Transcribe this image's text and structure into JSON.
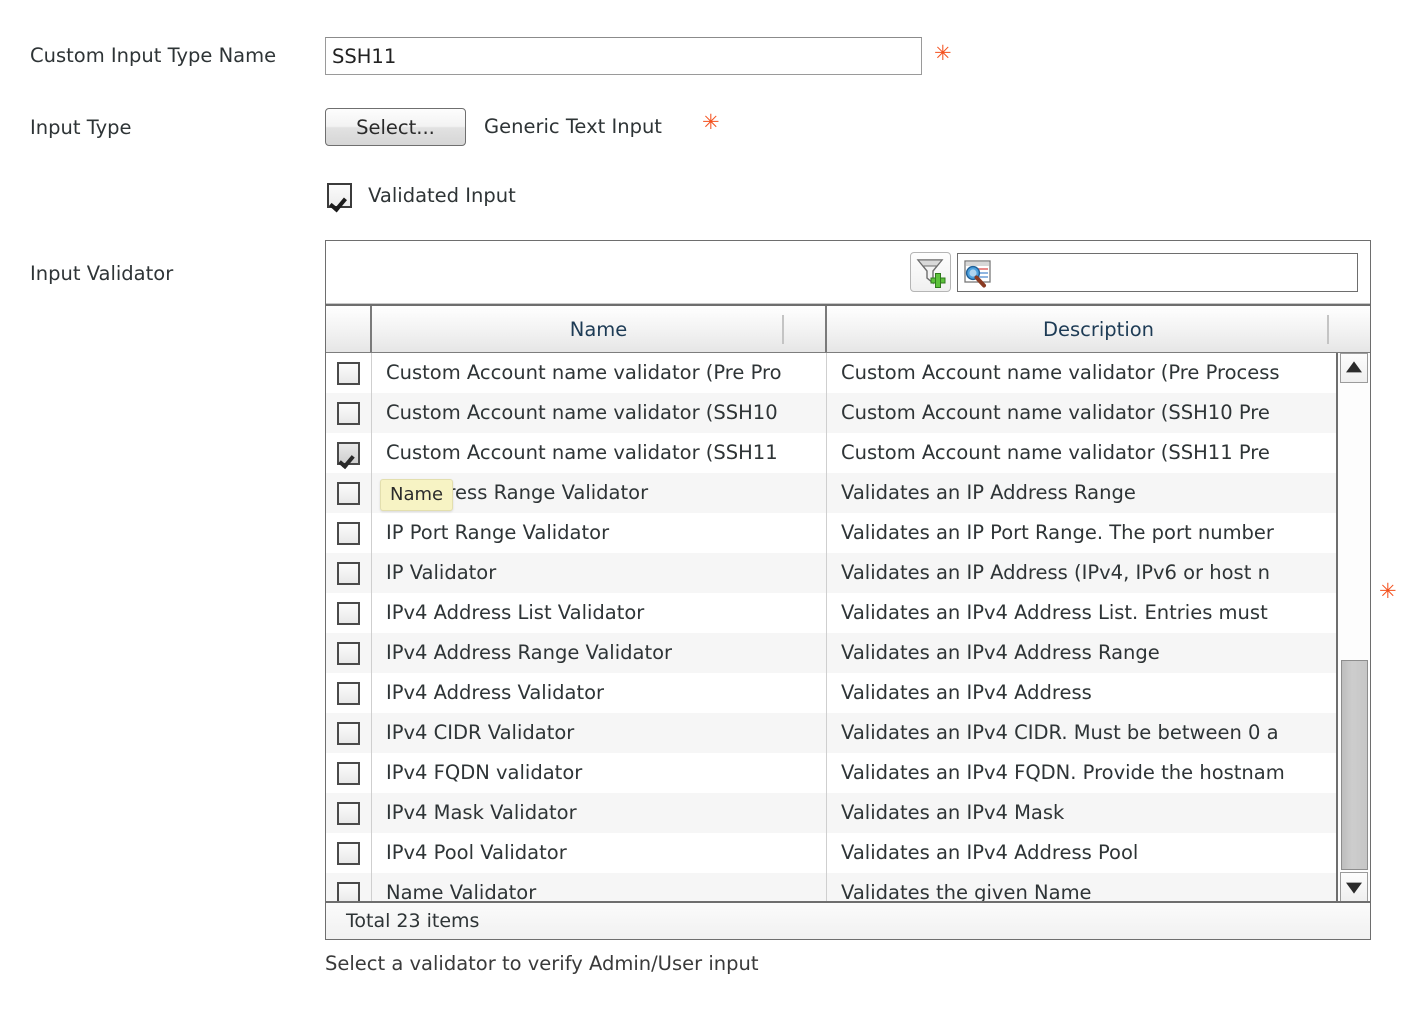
{
  "form": {
    "name_field": {
      "label": "Custom Input Type Name",
      "value": "SSH11",
      "placeholder": "",
      "required_marker": "✳"
    },
    "input_type": {
      "label": "Input Type",
      "select_button": "Select...",
      "value": "Generic Text Input",
      "required_marker": "✳"
    },
    "validated_input": {
      "label": "Validated Input",
      "checked": true
    },
    "input_validator": {
      "label": "Input Validator",
      "required_marker": "✳"
    },
    "hint": "Select a validator to verify Admin/User input"
  },
  "grid": {
    "toolbar": {
      "filter_icon": "funnel-add-icon",
      "search_icon": "search-records-icon",
      "search_value": "",
      "search_placeholder": ""
    },
    "columns": [
      {
        "key": "check",
        "label": ""
      },
      {
        "key": "name",
        "label": "Name"
      },
      {
        "key": "description",
        "label": "Description"
      }
    ],
    "tooltip": "Name",
    "footer": "Total 23 items",
    "scrollbar": {
      "up_arrow": "▲",
      "down_arrow": "▼"
    },
    "rows": [
      {
        "checked": false,
        "name": "Custom Account name validator (Pre Pro",
        "description": "Custom Account name validator (Pre Process"
      },
      {
        "checked": false,
        "name": "Custom Account name validator (SSH10",
        "description": "Custom Account name validator (SSH10 Pre"
      },
      {
        "checked": true,
        "name": "Custom Account name validator (SSH11",
        "description": "Custom Account name validator (SSH11 Pre"
      },
      {
        "checked": false,
        "name": "IP Address Range Validator",
        "description": "Validates an IP Address Range"
      },
      {
        "checked": false,
        "name": "IP Port Range Validator",
        "description": "Validates an IP Port Range. The port number"
      },
      {
        "checked": false,
        "name": "IP Validator",
        "description": "Validates an IP Address (IPv4, IPv6 or host n"
      },
      {
        "checked": false,
        "name": "IPv4 Address List Validator",
        "description": "Validates an IPv4 Address List. Entries must"
      },
      {
        "checked": false,
        "name": "IPv4 Address Range Validator",
        "description": "Validates an IPv4 Address Range"
      },
      {
        "checked": false,
        "name": "IPv4 Address Validator",
        "description": "Validates an IPv4 Address"
      },
      {
        "checked": false,
        "name": "IPv4 CIDR Validator",
        "description": "Validates an IPv4 CIDR. Must be between 0 a"
      },
      {
        "checked": false,
        "name": "IPv4 FQDN validator",
        "description": "Validates an IPv4 FQDN. Provide the hostnam"
      },
      {
        "checked": false,
        "name": "IPv4 Mask Validator",
        "description": "Validates an IPv4 Mask"
      },
      {
        "checked": false,
        "name": "IPv4 Pool Validator",
        "description": "Validates an IPv4 Address Pool"
      },
      {
        "checked": false,
        "name": "Name Validator",
        "description": "Validates the given Name"
      }
    ]
  },
  "colors": {
    "required_marker": "#f4511e",
    "header_text": "#1d3b55",
    "tooltip_bg": "#f7f3c4",
    "row_alt": "#f6f6f6",
    "border": "#6e6e6e"
  }
}
